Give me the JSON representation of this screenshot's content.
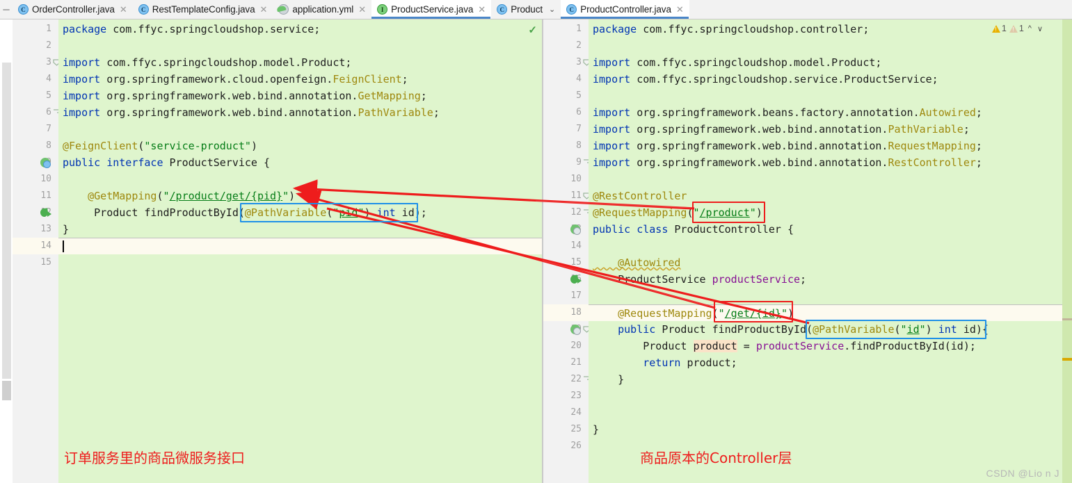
{
  "window": {
    "collapse_icon": "minus-icon",
    "watermark": "CSDN @Lio n   J"
  },
  "tabs": [
    {
      "label": "OrderController.java",
      "icon": "java-class-icon",
      "icon_letter": "C",
      "active": false,
      "closable": true
    },
    {
      "label": "RestTemplateConfig.java",
      "icon": "java-class-icon",
      "icon_letter": "C",
      "active": false,
      "closable": true
    },
    {
      "label": "application.yml",
      "icon": "spring-yaml-icon",
      "icon_letter": "",
      "active": false,
      "closable": true
    },
    {
      "label": "ProductService.java",
      "icon": "java-interface-icon",
      "icon_letter": "I",
      "active": true,
      "closable": true
    },
    {
      "label": "Product",
      "icon": "java-class-icon",
      "icon_letter": "C",
      "active": false,
      "closable": false,
      "chevron": "⌄"
    },
    {
      "label": "ProductController.java",
      "icon": "java-class-icon",
      "icon_letter": "C",
      "active": true,
      "closable": true
    }
  ],
  "left_editor": {
    "file": "ProductService.java",
    "status_icon": "check-ok-icon",
    "current_line": 14,
    "lines": [
      {
        "n": 1,
        "gutter_icon": "",
        "fold": "",
        "tokens": [
          {
            "t": "package ",
            "c": "k"
          },
          {
            "t": "com.ffyc.springcloudshop.service;",
            "c": "pl"
          }
        ]
      },
      {
        "n": 2,
        "gutter_icon": "",
        "fold": "",
        "tokens": []
      },
      {
        "n": 3,
        "gutter_icon": "",
        "fold": "collapse",
        "tokens": [
          {
            "t": "import ",
            "c": "k"
          },
          {
            "t": "com.ffyc.springcloudshop.model.Product;",
            "c": "pl"
          }
        ]
      },
      {
        "n": 4,
        "gutter_icon": "",
        "fold": "",
        "tokens": [
          {
            "t": "import ",
            "c": "k"
          },
          {
            "t": "org.springframework.cloud.openfeign.",
            "c": "pl"
          },
          {
            "t": "FeignClient",
            "c": "an"
          },
          {
            "t": ";",
            "c": "pl"
          }
        ]
      },
      {
        "n": 5,
        "gutter_icon": "",
        "fold": "",
        "tokens": [
          {
            "t": "import ",
            "c": "k"
          },
          {
            "t": "org.springframework.web.bind.annotation.",
            "c": "pl"
          },
          {
            "t": "GetMapping",
            "c": "an"
          },
          {
            "t": ";",
            "c": "pl"
          }
        ]
      },
      {
        "n": 6,
        "gutter_icon": "",
        "fold": "end",
        "tokens": [
          {
            "t": "import ",
            "c": "k"
          },
          {
            "t": "org.springframework.web.bind.annotation.",
            "c": "pl"
          },
          {
            "t": "PathVariable",
            "c": "an"
          },
          {
            "t": ";",
            "c": "pl"
          }
        ]
      },
      {
        "n": 7,
        "gutter_icon": "",
        "fold": "",
        "tokens": []
      },
      {
        "n": 8,
        "gutter_icon": "",
        "fold": "",
        "tokens": [
          {
            "t": "@FeignClient",
            "c": "an"
          },
          {
            "t": "(",
            "c": "pl"
          },
          {
            "t": "\"service-product\"",
            "c": "st"
          },
          {
            "t": ")",
            "c": "pl"
          }
        ]
      },
      {
        "n": 9,
        "gutter_icon": "interface-marker",
        "fold": "",
        "tokens": [
          {
            "t": "public interface ",
            "c": "k"
          },
          {
            "t": "ProductService {",
            "c": "pl"
          }
        ]
      },
      {
        "n": 10,
        "gutter_icon": "",
        "fold": "",
        "tokens": []
      },
      {
        "n": 11,
        "gutter_icon": "",
        "fold": "",
        "tokens": [
          {
            "t": "    @GetMapping",
            "c": "an"
          },
          {
            "t": "(",
            "c": "pl"
          },
          {
            "t": "\"",
            "c": "st"
          },
          {
            "t": "/product/get/{pid}",
            "c": "stu"
          },
          {
            "t": "\"",
            "c": "st"
          },
          {
            "t": ")",
            "c": "pl"
          }
        ]
      },
      {
        "n": 12,
        "gutter_icon": "implements-marker",
        "fold": "",
        "tokens": [
          {
            "t": "     Product findProductById(",
            "c": "pl"
          },
          {
            "t": "@PathVariable",
            "c": "an"
          },
          {
            "t": "(",
            "c": "pl"
          },
          {
            "t": "\"",
            "c": "st"
          },
          {
            "t": "pid",
            "c": "stu"
          },
          {
            "t": "\"",
            "c": "st"
          },
          {
            "t": ") ",
            "c": "pl"
          },
          {
            "t": "int",
            "c": "k"
          },
          {
            "t": " id);",
            "c": "pl"
          }
        ]
      },
      {
        "n": 13,
        "gutter_icon": "",
        "fold": "",
        "tokens": [
          {
            "t": "}",
            "c": "pl"
          }
        ]
      },
      {
        "n": 14,
        "gutter_icon": "",
        "fold": "",
        "tokens": []
      },
      {
        "n": 15,
        "gutter_icon": "",
        "fold": "",
        "tokens": []
      }
    ]
  },
  "right_editor": {
    "file": "ProductController.java",
    "current_line": 18,
    "inspections": [
      {
        "type": "warning",
        "icon": "warning-triangle-icon",
        "count": "1",
        "color": "#e8b100"
      },
      {
        "type": "weak-warning",
        "icon": "weak-warning-triangle-icon",
        "count": "1",
        "color": "#dfc9a8"
      }
    ],
    "nav_up_icon": "chevron-up-icon",
    "nav_down_icon": "chevron-down-icon",
    "lines": [
      {
        "n": 1,
        "gutter_icon": "",
        "fold": "",
        "tokens": [
          {
            "t": "package ",
            "c": "k"
          },
          {
            "t": "com.ffyc.springcloudshop.controller;",
            "c": "pl"
          }
        ]
      },
      {
        "n": 2,
        "gutter_icon": "",
        "fold": "",
        "tokens": []
      },
      {
        "n": 3,
        "gutter_icon": "",
        "fold": "collapse",
        "tokens": [
          {
            "t": "import ",
            "c": "k"
          },
          {
            "t": "com.ffyc.springcloudshop.model.Product;",
            "c": "pl"
          }
        ]
      },
      {
        "n": 4,
        "gutter_icon": "",
        "fold": "",
        "tokens": [
          {
            "t": "import ",
            "c": "k"
          },
          {
            "t": "com.ffyc.springcloudshop.service.ProductService;",
            "c": "pl"
          }
        ]
      },
      {
        "n": 5,
        "gutter_icon": "",
        "fold": "",
        "tokens": []
      },
      {
        "n": 6,
        "gutter_icon": "",
        "fold": "",
        "tokens": [
          {
            "t": "import ",
            "c": "k"
          },
          {
            "t": "org.springframework.beans.factory.annotation.",
            "c": "pl"
          },
          {
            "t": "Autowired",
            "c": "an"
          },
          {
            "t": ";",
            "c": "pl"
          }
        ]
      },
      {
        "n": 7,
        "gutter_icon": "",
        "fold": "",
        "tokens": [
          {
            "t": "import ",
            "c": "k"
          },
          {
            "t": "org.springframework.web.bind.annotation.",
            "c": "pl"
          },
          {
            "t": "PathVariable",
            "c": "an"
          },
          {
            "t": ";",
            "c": "pl"
          }
        ]
      },
      {
        "n": 8,
        "gutter_icon": "",
        "fold": "",
        "tokens": [
          {
            "t": "import ",
            "c": "k"
          },
          {
            "t": "org.springframework.web.bind.annotation.",
            "c": "pl"
          },
          {
            "t": "RequestMapping",
            "c": "an"
          },
          {
            "t": ";",
            "c": "pl"
          }
        ]
      },
      {
        "n": 9,
        "gutter_icon": "",
        "fold": "end",
        "tokens": [
          {
            "t": "import ",
            "c": "k"
          },
          {
            "t": "org.springframework.web.bind.annotation.",
            "c": "pl"
          },
          {
            "t": "RestController",
            "c": "an"
          },
          {
            "t": ";",
            "c": "pl"
          }
        ]
      },
      {
        "n": 10,
        "gutter_icon": "",
        "fold": "",
        "tokens": []
      },
      {
        "n": 11,
        "gutter_icon": "",
        "fold": "collapse",
        "tokens": [
          {
            "t": "@RestController",
            "c": "an"
          }
        ]
      },
      {
        "n": 12,
        "gutter_icon": "",
        "fold": "end",
        "tokens": [
          {
            "t": "@RequestMapping",
            "c": "an"
          },
          {
            "t": "(",
            "c": "pl"
          },
          {
            "t": "\"",
            "c": "st"
          },
          {
            "t": "/product",
            "c": "stu"
          },
          {
            "t": "\"",
            "c": "st"
          },
          {
            "t": ")",
            "c": "pl"
          }
        ]
      },
      {
        "n": 13,
        "gutter_icon": "class-marker",
        "fold": "",
        "tokens": [
          {
            "t": "public class ",
            "c": "k"
          },
          {
            "t": "ProductController {",
            "c": "pl"
          }
        ]
      },
      {
        "n": 14,
        "gutter_icon": "",
        "fold": "",
        "tokens": []
      },
      {
        "n": 15,
        "gutter_icon": "",
        "fold": "",
        "tokens": [
          {
            "t": "    @Autowired",
            "c": "an wavy"
          }
        ]
      },
      {
        "n": 16,
        "gutter_icon": "implements-marker",
        "fold": "",
        "tokens": [
          {
            "t": "    ProductService ",
            "c": "pl"
          },
          {
            "t": "productService",
            "c": "fd"
          },
          {
            "t": ";",
            "c": "pl"
          }
        ]
      },
      {
        "n": 17,
        "gutter_icon": "",
        "fold": "",
        "tokens": []
      },
      {
        "n": 18,
        "gutter_icon": "",
        "fold": "",
        "tokens": [
          {
            "t": "    @RequestMapping",
            "c": "an"
          },
          {
            "t": "(",
            "c": "pl"
          },
          {
            "t": "\"",
            "c": "st"
          },
          {
            "t": "/get/{id}",
            "c": "stu"
          },
          {
            "t": "\"",
            "c": "st"
          },
          {
            "t": ")",
            "c": "pl"
          }
        ]
      },
      {
        "n": 19,
        "gutter_icon": "class-marker",
        "fold": "collapse",
        "tokens": [
          {
            "t": "    public ",
            "c": "k"
          },
          {
            "t": "Product ",
            "c": "pl"
          },
          {
            "t": "findProductById",
            "c": "pl"
          },
          {
            "t": "(",
            "c": "pl"
          },
          {
            "t": "@PathVariable",
            "c": "an"
          },
          {
            "t": "(",
            "c": "pl"
          },
          {
            "t": "\"",
            "c": "st"
          },
          {
            "t": "id",
            "c": "stu"
          },
          {
            "t": "\"",
            "c": "st"
          },
          {
            "t": ") ",
            "c": "pl"
          },
          {
            "t": "int",
            "c": "k"
          },
          {
            "t": " id){",
            "c": "pl"
          }
        ]
      },
      {
        "n": 20,
        "gutter_icon": "",
        "fold": "",
        "tokens": [
          {
            "t": "        Product ",
            "c": "pl"
          },
          {
            "t": "product",
            "c": "hl-param"
          },
          {
            "t": " = ",
            "c": "pl"
          },
          {
            "t": "productService",
            "c": "fd"
          },
          {
            "t": ".findProductById(id);",
            "c": "pl"
          }
        ]
      },
      {
        "n": 21,
        "gutter_icon": "",
        "fold": "",
        "tokens": [
          {
            "t": "        ",
            "c": "pl"
          },
          {
            "t": "return",
            "c": "k"
          },
          {
            "t": " product;",
            "c": "pl"
          }
        ]
      },
      {
        "n": 22,
        "gutter_icon": "",
        "fold": "end",
        "tokens": [
          {
            "t": "    }",
            "c": "pl"
          }
        ]
      },
      {
        "n": 23,
        "gutter_icon": "",
        "fold": "",
        "tokens": []
      },
      {
        "n": 24,
        "gutter_icon": "",
        "fold": "",
        "tokens": []
      },
      {
        "n": 25,
        "gutter_icon": "",
        "fold": "",
        "tokens": [
          {
            "t": "}",
            "c": "pl"
          }
        ]
      },
      {
        "n": 26,
        "gutter_icon": "",
        "fold": "",
        "tokens": []
      }
    ]
  },
  "annotations": {
    "colors": {
      "red": "#ee1c1c",
      "blue": "#1e90e8"
    },
    "notes": [
      {
        "id": "left-note",
        "text": "订单服务里的商品微服务接口"
      },
      {
        "id": "right-note",
        "text": "商品原本的Controller层"
      }
    ],
    "red_boxes": [
      {
        "id": "product-mapping-box",
        "target": "\"/product\""
      },
      {
        "id": "get-id-mapping-box",
        "target": "\"/get/{id}\""
      }
    ],
    "blue_boxes": [
      {
        "id": "left-pathvariable-box",
        "target": "@PathVariable(\"pid\") int id"
      },
      {
        "id": "right-pathvariable-box",
        "target": "@PathVariable(\"id\") int id"
      }
    ],
    "arrows": [
      {
        "id": "arrow-product-to-getmapping",
        "from": "\"/product\"",
        "to": "@GetMapping(\"/product/get/{pid}\")"
      },
      {
        "id": "arrow-getid-to-getmapping",
        "from": "\"/get/{id}\"",
        "to": "@GetMapping(\"/product/get/{pid}\")"
      },
      {
        "id": "arrow-pathvariable-link",
        "from": "right @PathVariable",
        "to": "left @PathVariable"
      }
    ]
  }
}
